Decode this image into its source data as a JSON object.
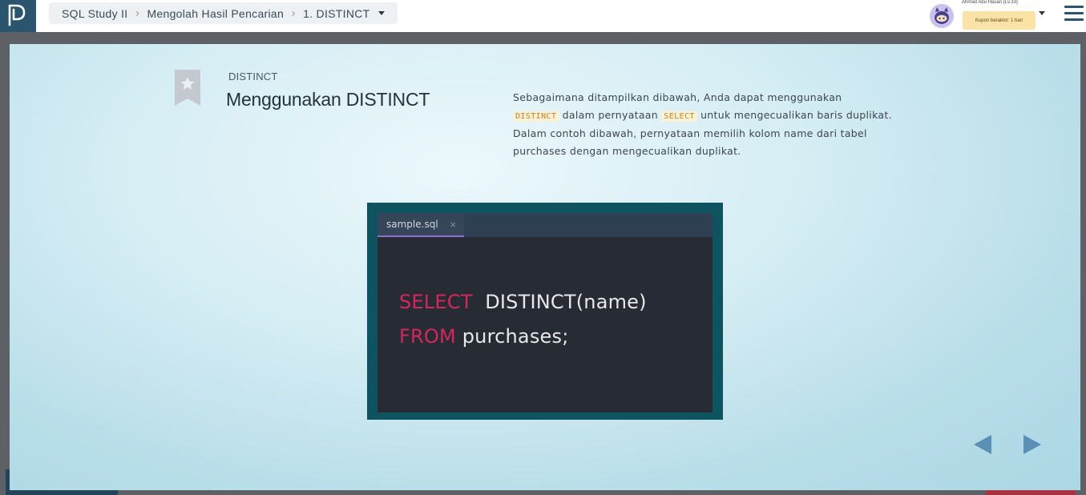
{
  "app": {
    "logo_icon": "progate-logo-icon",
    "brand_color": "#2b546f"
  },
  "breadcrumb": {
    "items": [
      "SQL Study II",
      "Mengolah Hasil Pencarian",
      "1. DISTINCT"
    ],
    "separator_icon": "chevron-right-icon",
    "dropdown_icon": "caret-down-icon"
  },
  "user": {
    "name": "Ahmad Abu Hasan (Lv.33)",
    "coupon": "Kupon berakhir: 1 hari",
    "avatar_icon": "ninja-cat-avatar-icon",
    "menu_icon": "hamburger-menu-icon"
  },
  "slide": {
    "bookmark_icon": "star-bookmark-icon",
    "kicker": "DISTINCT",
    "title": "Menggunakan DISTINCT",
    "desc": {
      "line1": "Sebagaimana ditampilkan dibawah, Anda dapat menggunakan",
      "kw1": "DISTINCT",
      "mid1": " dalam pernyataan ",
      "kw2": "SELECT",
      "rest": " untuk mengecualikan baris duplikat. Dalam contoh dibawah, pernyataan memilih kolom name dari tabel purchases dengan mengecualikan duplikat."
    },
    "code": {
      "tab_name": "sample.sql",
      "tab_close": "×",
      "line1_kw": "SELECT",
      "line1_rest": "  DISTINCT(name)",
      "line2_kw": "FROM",
      "line2_rest": " purchases;",
      "keyword_color": "#d6265f"
    },
    "nav": {
      "prev_icon": "arrow-left-icon",
      "next_icon": "arrow-right-icon",
      "arrow_color": "#5a8fb6"
    }
  }
}
